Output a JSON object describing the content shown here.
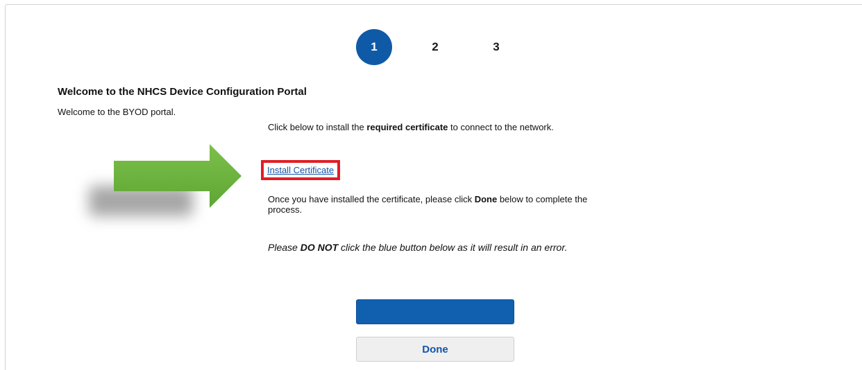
{
  "steps": [
    {
      "label": "1",
      "active": true
    },
    {
      "label": "2",
      "active": false
    },
    {
      "label": "3",
      "active": false
    }
  ],
  "page": {
    "title": "Welcome to the NHCS Device Configuration Portal",
    "intro": "Welcome to the BYOD portal."
  },
  "instructions": {
    "p1_before": "Click below to install the ",
    "p1_bold": "required certificate",
    "p1_after": " to connect to the network.",
    "install_link": "Install Certificate",
    "p2_before": "Once you have installed the certificate, please click ",
    "p2_bold": "Done",
    "p2_after": " below to complete the process.",
    "warn_before": "Please ",
    "warn_bold": "DO NOT",
    "warn_after": " click the blue button below as it will result in an error."
  },
  "buttons": {
    "primary_label": "",
    "done_label": "Done"
  },
  "colors": {
    "accent_blue": "#1160b0",
    "highlight_red": "#e01e26",
    "arrow_green": "#6db33f"
  },
  "icons": {
    "annotation_arrow": "right-arrow-icon"
  }
}
